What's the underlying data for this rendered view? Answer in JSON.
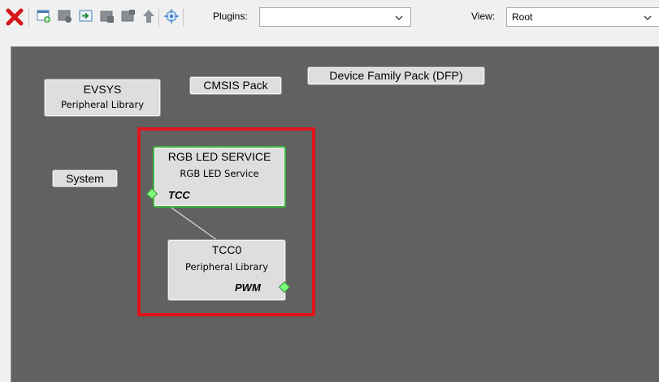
{
  "toolbar": {
    "plugins_label": "Plugins:",
    "plugins_value": "",
    "view_label": "View:",
    "view_value": "Root",
    "icons": [
      "close-red-x-icon",
      "new-component-icon",
      "group-icon",
      "import-icon",
      "export-icon",
      "delete-icon",
      "move-up-icon",
      "center-view-icon"
    ]
  },
  "canvas": {
    "nodes": [
      {
        "title": "EVSYS",
        "subtitle": "Peripheral Library"
      },
      {
        "title": "CMSIS Pack"
      },
      {
        "title": "Device Family Pack (DFP)"
      },
      {
        "title": "System"
      },
      {
        "title": "RGB LED SERVICE",
        "subtitle": "RGB LED Service",
        "port": "TCC",
        "selected": true
      },
      {
        "title": "TCC0",
        "subtitle": "Peripheral Library",
        "port": "PWM"
      }
    ],
    "colors": {
      "background": "#616161",
      "highlight": "#e0151b",
      "selected_border": "#3cb33c",
      "connector": "#7cff7c"
    }
  }
}
